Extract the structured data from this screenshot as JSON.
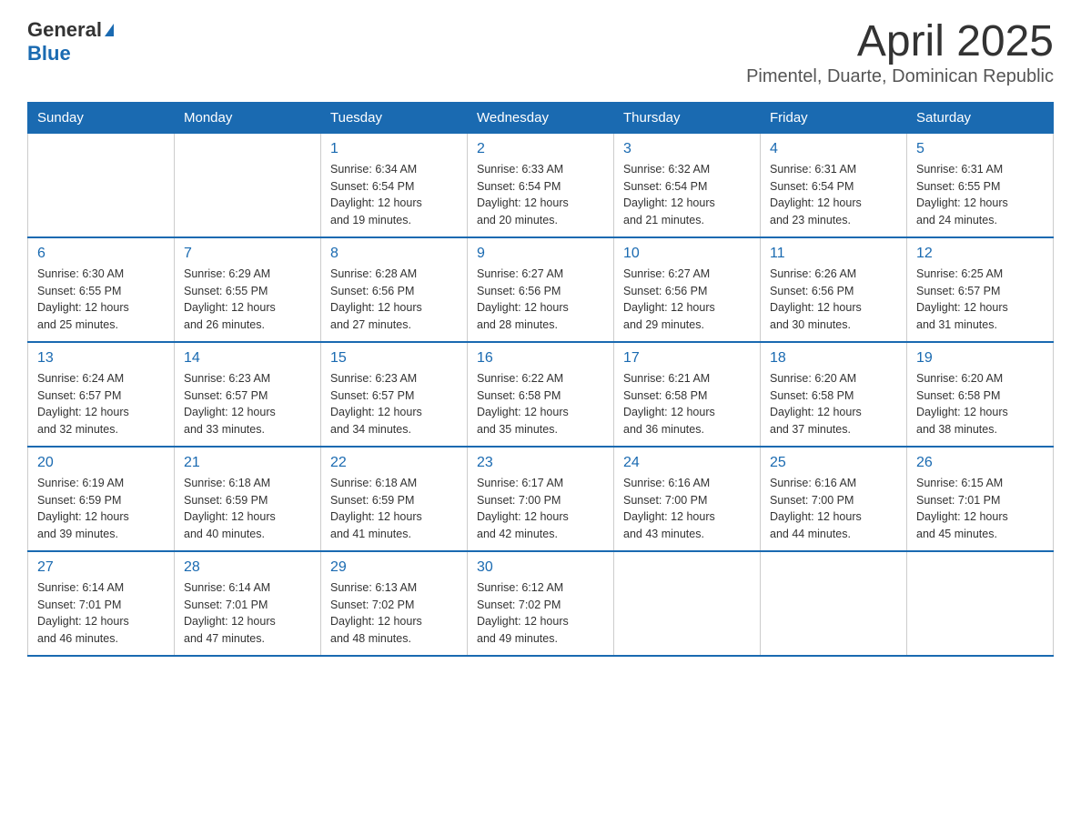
{
  "header": {
    "logo": {
      "general": "General",
      "blue": "Blue"
    },
    "title": "April 2025",
    "subtitle": "Pimentel, Duarte, Dominican Republic"
  },
  "calendar": {
    "days_of_week": [
      "Sunday",
      "Monday",
      "Tuesday",
      "Wednesday",
      "Thursday",
      "Friday",
      "Saturday"
    ],
    "weeks": [
      [
        {
          "day": "",
          "info": ""
        },
        {
          "day": "",
          "info": ""
        },
        {
          "day": "1",
          "info": "Sunrise: 6:34 AM\nSunset: 6:54 PM\nDaylight: 12 hours\nand 19 minutes."
        },
        {
          "day": "2",
          "info": "Sunrise: 6:33 AM\nSunset: 6:54 PM\nDaylight: 12 hours\nand 20 minutes."
        },
        {
          "day": "3",
          "info": "Sunrise: 6:32 AM\nSunset: 6:54 PM\nDaylight: 12 hours\nand 21 minutes."
        },
        {
          "day": "4",
          "info": "Sunrise: 6:31 AM\nSunset: 6:54 PM\nDaylight: 12 hours\nand 23 minutes."
        },
        {
          "day": "5",
          "info": "Sunrise: 6:31 AM\nSunset: 6:55 PM\nDaylight: 12 hours\nand 24 minutes."
        }
      ],
      [
        {
          "day": "6",
          "info": "Sunrise: 6:30 AM\nSunset: 6:55 PM\nDaylight: 12 hours\nand 25 minutes."
        },
        {
          "day": "7",
          "info": "Sunrise: 6:29 AM\nSunset: 6:55 PM\nDaylight: 12 hours\nand 26 minutes."
        },
        {
          "day": "8",
          "info": "Sunrise: 6:28 AM\nSunset: 6:56 PM\nDaylight: 12 hours\nand 27 minutes."
        },
        {
          "day": "9",
          "info": "Sunrise: 6:27 AM\nSunset: 6:56 PM\nDaylight: 12 hours\nand 28 minutes."
        },
        {
          "day": "10",
          "info": "Sunrise: 6:27 AM\nSunset: 6:56 PM\nDaylight: 12 hours\nand 29 minutes."
        },
        {
          "day": "11",
          "info": "Sunrise: 6:26 AM\nSunset: 6:56 PM\nDaylight: 12 hours\nand 30 minutes."
        },
        {
          "day": "12",
          "info": "Sunrise: 6:25 AM\nSunset: 6:57 PM\nDaylight: 12 hours\nand 31 minutes."
        }
      ],
      [
        {
          "day": "13",
          "info": "Sunrise: 6:24 AM\nSunset: 6:57 PM\nDaylight: 12 hours\nand 32 minutes."
        },
        {
          "day": "14",
          "info": "Sunrise: 6:23 AM\nSunset: 6:57 PM\nDaylight: 12 hours\nand 33 minutes."
        },
        {
          "day": "15",
          "info": "Sunrise: 6:23 AM\nSunset: 6:57 PM\nDaylight: 12 hours\nand 34 minutes."
        },
        {
          "day": "16",
          "info": "Sunrise: 6:22 AM\nSunset: 6:58 PM\nDaylight: 12 hours\nand 35 minutes."
        },
        {
          "day": "17",
          "info": "Sunrise: 6:21 AM\nSunset: 6:58 PM\nDaylight: 12 hours\nand 36 minutes."
        },
        {
          "day": "18",
          "info": "Sunrise: 6:20 AM\nSunset: 6:58 PM\nDaylight: 12 hours\nand 37 minutes."
        },
        {
          "day": "19",
          "info": "Sunrise: 6:20 AM\nSunset: 6:58 PM\nDaylight: 12 hours\nand 38 minutes."
        }
      ],
      [
        {
          "day": "20",
          "info": "Sunrise: 6:19 AM\nSunset: 6:59 PM\nDaylight: 12 hours\nand 39 minutes."
        },
        {
          "day": "21",
          "info": "Sunrise: 6:18 AM\nSunset: 6:59 PM\nDaylight: 12 hours\nand 40 minutes."
        },
        {
          "day": "22",
          "info": "Sunrise: 6:18 AM\nSunset: 6:59 PM\nDaylight: 12 hours\nand 41 minutes."
        },
        {
          "day": "23",
          "info": "Sunrise: 6:17 AM\nSunset: 7:00 PM\nDaylight: 12 hours\nand 42 minutes."
        },
        {
          "day": "24",
          "info": "Sunrise: 6:16 AM\nSunset: 7:00 PM\nDaylight: 12 hours\nand 43 minutes."
        },
        {
          "day": "25",
          "info": "Sunrise: 6:16 AM\nSunset: 7:00 PM\nDaylight: 12 hours\nand 44 minutes."
        },
        {
          "day": "26",
          "info": "Sunrise: 6:15 AM\nSunset: 7:01 PM\nDaylight: 12 hours\nand 45 minutes."
        }
      ],
      [
        {
          "day": "27",
          "info": "Sunrise: 6:14 AM\nSunset: 7:01 PM\nDaylight: 12 hours\nand 46 minutes."
        },
        {
          "day": "28",
          "info": "Sunrise: 6:14 AM\nSunset: 7:01 PM\nDaylight: 12 hours\nand 47 minutes."
        },
        {
          "day": "29",
          "info": "Sunrise: 6:13 AM\nSunset: 7:02 PM\nDaylight: 12 hours\nand 48 minutes."
        },
        {
          "day": "30",
          "info": "Sunrise: 6:12 AM\nSunset: 7:02 PM\nDaylight: 12 hours\nand 49 minutes."
        },
        {
          "day": "",
          "info": ""
        },
        {
          "day": "",
          "info": ""
        },
        {
          "day": "",
          "info": ""
        }
      ]
    ]
  }
}
